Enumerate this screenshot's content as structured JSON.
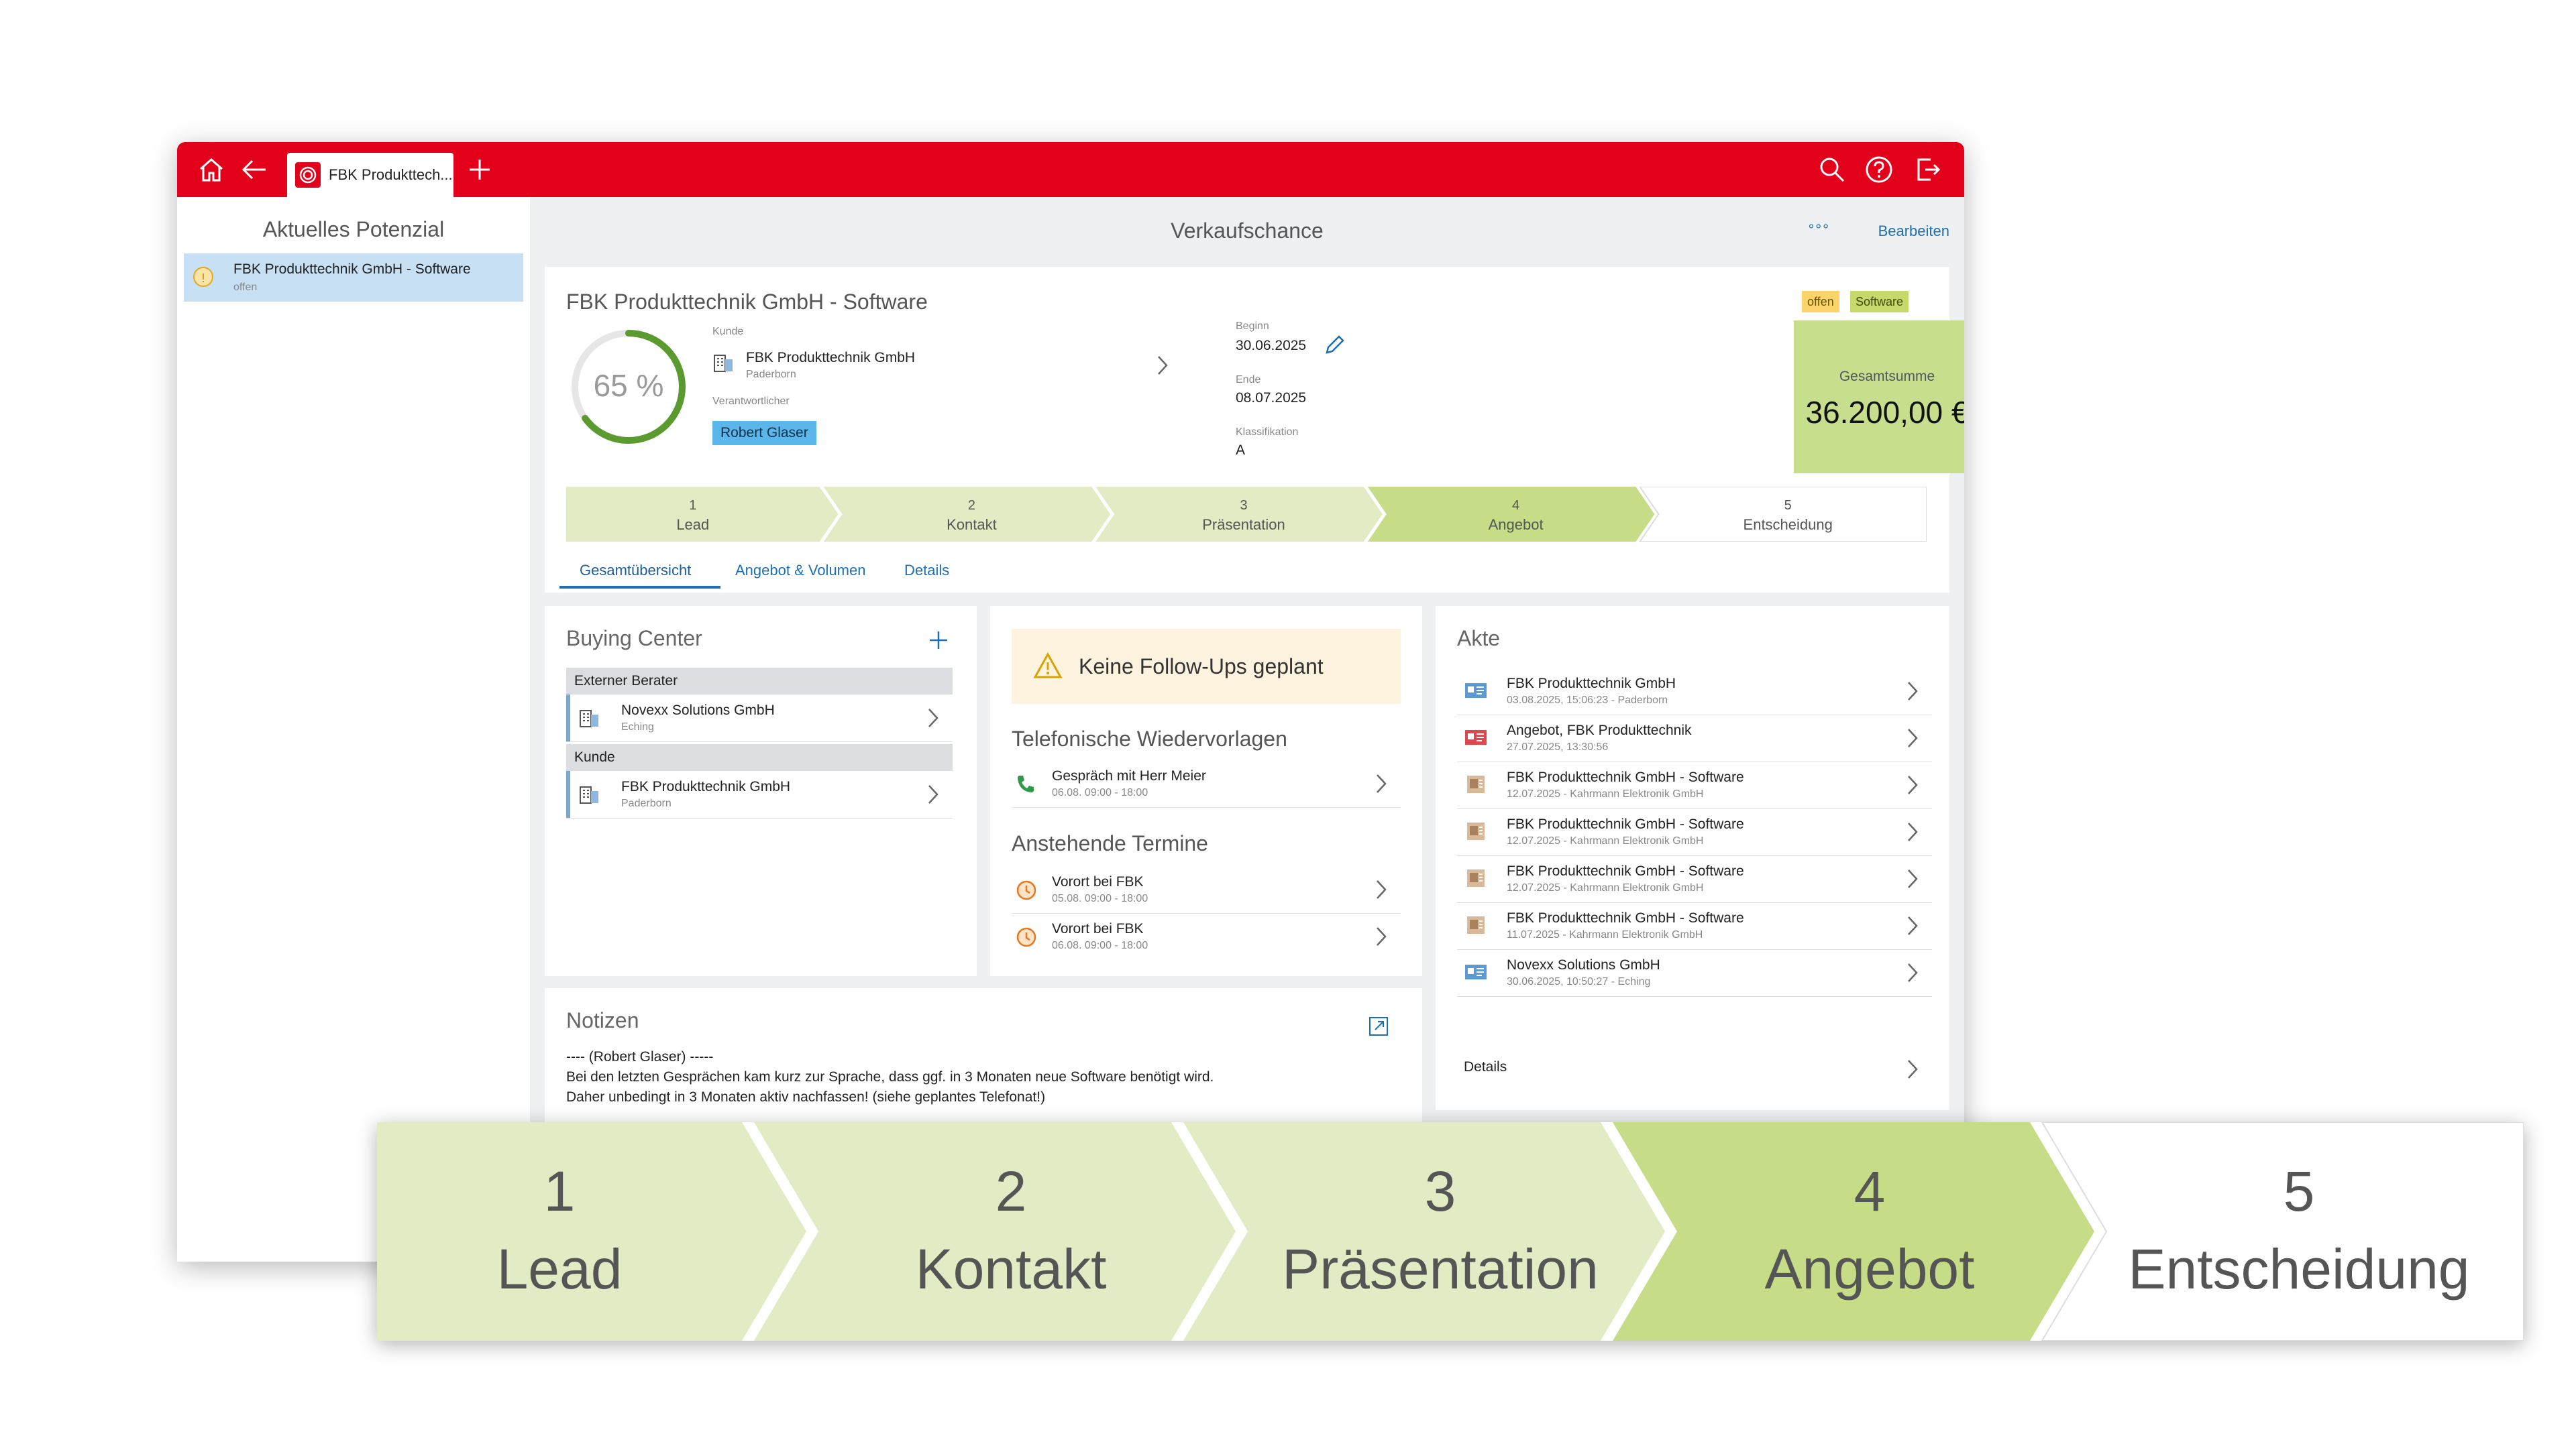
{
  "window": {
    "tab_title": "FBK Produkttech...",
    "icons": [
      "home-icon",
      "back-arrow-icon",
      "add-tab-icon",
      "search-icon",
      "help-icon",
      "logout-icon"
    ]
  },
  "sidebar": {
    "title": "Aktuelles Potenzial",
    "items": [
      {
        "badge": "!",
        "name": "FBK Produkttechnik GmbH - Software",
        "status": "offen"
      }
    ]
  },
  "main": {
    "title": "Verkaufschance",
    "more": "°°°",
    "edit": "Bearbeiten"
  },
  "opportunity": {
    "title": "FBK Produkttechnik GmbH - Software",
    "probability": 65,
    "probability_text": "65 %",
    "customer_label": "Kunde",
    "customer_name": "FBK Produkttechnik GmbH",
    "customer_city": "Paderborn",
    "owner_label": "Verantwortlicher",
    "owner": "Robert Glaser",
    "begin_label": "Beginn",
    "begin": "30.06.2025",
    "end_label": "Ende",
    "end": "08.07.2025",
    "class_label": "Klassifikation",
    "class": "A",
    "tags": [
      "offen",
      "Software"
    ],
    "total_label": "Gesamtsumme",
    "total": "36.200,00 €"
  },
  "stages": [
    {
      "num": "1",
      "label": "Lead"
    },
    {
      "num": "2",
      "label": "Kontakt"
    },
    {
      "num": "3",
      "label": "Präsentation"
    },
    {
      "num": "4",
      "label": "Angebot"
    },
    {
      "num": "5",
      "label": "Entscheidung"
    }
  ],
  "active_stage": 4,
  "tabs": [
    "Gesamtübersicht",
    "Angebot & Volumen",
    "Details"
  ],
  "buying_center": {
    "title": "Buying Center",
    "groups": [
      {
        "name": "Externer Berater",
        "entries": [
          {
            "name": "Novexx Solutions GmbH",
            "city": "Eching"
          }
        ]
      },
      {
        "name": "Kunde",
        "entries": [
          {
            "name": "FBK Produkttechnik GmbH",
            "city": "Paderborn"
          }
        ]
      }
    ]
  },
  "followups": {
    "warning": "Keine Follow-Ups geplant",
    "calls_title": "Telefonische Wiedervorlagen",
    "calls": [
      {
        "title": "Gespräch mit Herr Meier",
        "time": "06.08. 09:00 - 18:00"
      }
    ],
    "appointments_title": "Anstehende Termine",
    "appointments": [
      {
        "title": "Vorort bei FBK",
        "time": "05.08. 09:00 - 18:00"
      },
      {
        "title": "Vorort bei FBK",
        "time": "06.08. 09:00 - 18:00"
      }
    ]
  },
  "akte": {
    "title": "Akte",
    "items": [
      {
        "icon": "contact-card-icon",
        "name": "FBK Produkttechnik GmbH",
        "sub": "03.08.2025, 15:06:23 - Paderborn"
      },
      {
        "icon": "offer-document-icon",
        "name": "Angebot, FBK Produkttechnik",
        "sub": "27.07.2025, 13:30:56"
      },
      {
        "icon": "opportunity-document-icon",
        "name": "FBK Produkttechnik GmbH - Software",
        "sub": "12.07.2025 - Kahrmann Elektronik GmbH"
      },
      {
        "icon": "opportunity-document-icon",
        "name": "FBK Produkttechnik GmbH - Software",
        "sub": "12.07.2025 - Kahrmann Elektronik GmbH"
      },
      {
        "icon": "opportunity-document-icon",
        "name": "FBK Produkttechnik GmbH - Software",
        "sub": "12.07.2025 - Kahrmann Elektronik GmbH"
      },
      {
        "icon": "opportunity-document-icon",
        "name": "FBK Produkttechnik GmbH - Software",
        "sub": "11.07.2025 - Kahrmann Elektronik GmbH"
      },
      {
        "icon": "contact-card-icon",
        "name": "Novexx Solutions GmbH",
        "sub": "30.06.2025, 10:50:27 - Eching"
      }
    ],
    "details": "Details"
  },
  "notes": {
    "title": "Notizen",
    "lines": [
      "---- (Robert Glaser) -----",
      "Bei den letzten Gesprächen kam kurz zur Sprache, dass ggf. in 3 Monaten neue Software benötigt wird.",
      "Daher unbedingt in 3 Monaten aktiv nachfassen! (siehe geplantes Telefonat!)"
    ]
  },
  "colors": {
    "brand_red": "#e3001b",
    "stage_done": "#e1ecc4",
    "stage_active": "#c6dc86",
    "stage_open": "#ffffff",
    "gauge": "#5a9a2e",
    "link": "#1c6fb5"
  }
}
